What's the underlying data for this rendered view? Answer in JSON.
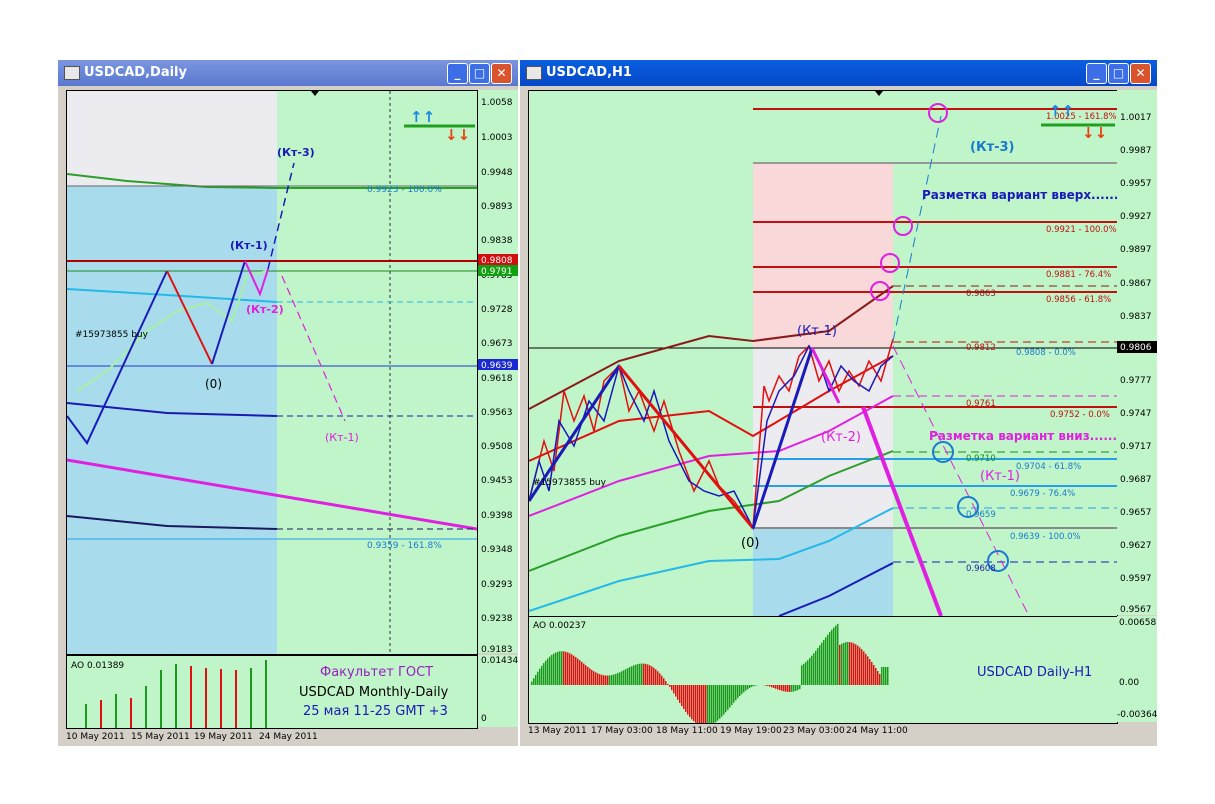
{
  "left": {
    "title": "USDCAD,Daily",
    "price_ticks": [
      "1.0058",
      "1.0003",
      "0.9948",
      "0.9893",
      "0.9838",
      "0.9783",
      "0.9728",
      "0.9673",
      "0.9618",
      "0.9563",
      "0.9508",
      "0.9453",
      "0.9398",
      "0.9348",
      "0.9293",
      "0.9238",
      "0.9183"
    ],
    "ao_ticks": [
      "0.01434",
      "0"
    ],
    "price_tags": {
      "red": "0.9808",
      "green": "0.9791",
      "blue": "0.9639"
    },
    "ao_label": "AO 0.01389",
    "date_labels": [
      "10 May 2011",
      "15 May 2011",
      "19 May 2011",
      "24 May 2011"
    ],
    "order_label": "#15973855 buy",
    "fib_top": "0.9923 - 100.0%",
    "fib_bottom": "0.9359 - 161.8%",
    "wave_labels": {
      "kt3": "(Кт-3)",
      "kt1": "(Кт-1)",
      "kt2": "(Кт-2)",
      "zero": "(0)",
      "kt1_down": "(Кт-1)"
    },
    "caption": {
      "line1": "Факультет ГОСТ",
      "line2": "USDCAD Monthly-Daily",
      "line3": "25 мая 11-25 GMT +3"
    }
  },
  "right": {
    "title": "USDCAD,H1",
    "price_ticks": [
      "1.0017",
      "0.9987",
      "0.9957",
      "0.9927",
      "0.9897",
      "0.9867",
      "0.9837",
      "0.9806",
      "0.9777",
      "0.9747",
      "0.9717",
      "0.9687",
      "0.9657",
      "0.9627",
      "0.9597",
      "0.9567"
    ],
    "ao_ticks": [
      "0.00658",
      "0.00",
      "-0.00364"
    ],
    "price_tag": "0.9806",
    "ao_label": "AO 0.00237",
    "date_labels": [
      "13 May 2011",
      "17 May 03:00",
      "18 May 11:00",
      "19 May 19:00",
      "23 May 03:00",
      "24 May 11:00"
    ],
    "order_label": "#15973855 buy",
    "fib_labels": {
      "f1618": "1.0025 - 161.8%",
      "f100": "0.9921 - 100.0%",
      "f764": "0.9881 - 76.4%",
      "f618": "0.9856 - 61.8%",
      "f0": "0.9808 - 0.0%",
      "l9863": "0.9863",
      "l9812": "0.9812",
      "l9761": "0.9761",
      "f0b": "0.9752 - 0.0%",
      "l9710": "0.9710",
      "f618b": "0.9704 - 61.8%",
      "f764b": "0.9679 - 76.4%",
      "l9659": "0.9659",
      "f100b": "0.9639 - 100.0%",
      "l9608": "0.9608"
    },
    "wave_labels": {
      "kt3": "(Кт-3)",
      "kt1": "(Кт-1)",
      "kt2": "(Кт-2)",
      "zero": "(0)",
      "kt1_down": "(Кт-1)"
    },
    "notes": {
      "up": "Разметка вариант вверх......",
      "down": "Разметка вариант вниз......"
    },
    "caption": "USDCAD Daily-H1"
  },
  "colors": {
    "chart_bg": "#bff5c8",
    "blue_zone": "#a8dcec",
    "pink_zone": "#f8d8d8",
    "gray_zone": "#ecebf0"
  }
}
